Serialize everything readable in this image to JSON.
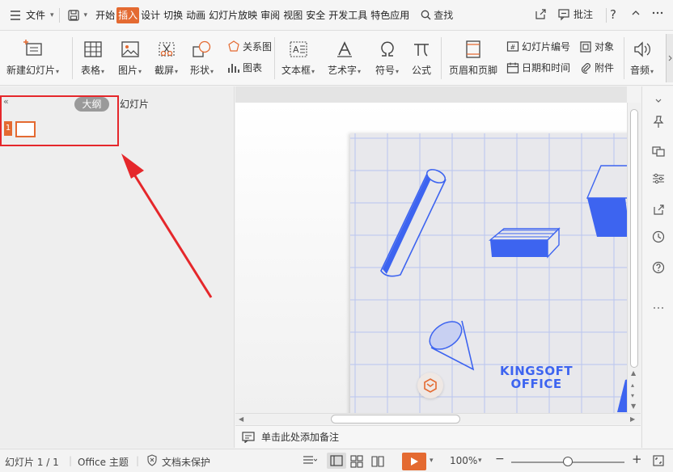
{
  "menubar": {
    "file_label": "文件",
    "tabs": [
      "开始",
      "插入",
      "设计",
      "切换",
      "动画",
      "幻灯片放映",
      "审阅",
      "视图",
      "安全",
      "开发工具",
      "特色应用"
    ],
    "active_tab": "插入",
    "search_label": "查找",
    "comment_label": "批注"
  },
  "ribbon": {
    "new_slide": "新建幻灯片",
    "table": "表格",
    "picture": "图片",
    "screenshot": "截屏",
    "shape": "形状",
    "relation": "关系图",
    "chart": "图表",
    "textbox": "文本框",
    "wordart": "艺术字",
    "symbol": "符号",
    "formula": "公式",
    "header_footer": "页眉和页脚",
    "slide_number": "幻灯片编号",
    "datetime": "日期和时间",
    "object": "对象",
    "attachment": "附件",
    "audio": "音频"
  },
  "leftpanel": {
    "collapse": "«",
    "outline_tab": "大纲",
    "slides_tab": "幻灯片",
    "thumb_number": "1"
  },
  "slide": {
    "brand_line1": "KINGSOFT",
    "brand_line2": "OFFICE",
    "accent": "#3d64f0"
  },
  "notes": {
    "placeholder": "单击此处添加备注"
  },
  "status": {
    "slide_info": "幻灯片 1 / 1",
    "theme": "Office 主题",
    "protection": "文档未保护",
    "zoom": "100%"
  },
  "colors": {
    "accent": "#e46a31",
    "annotation": "#e5272b"
  }
}
